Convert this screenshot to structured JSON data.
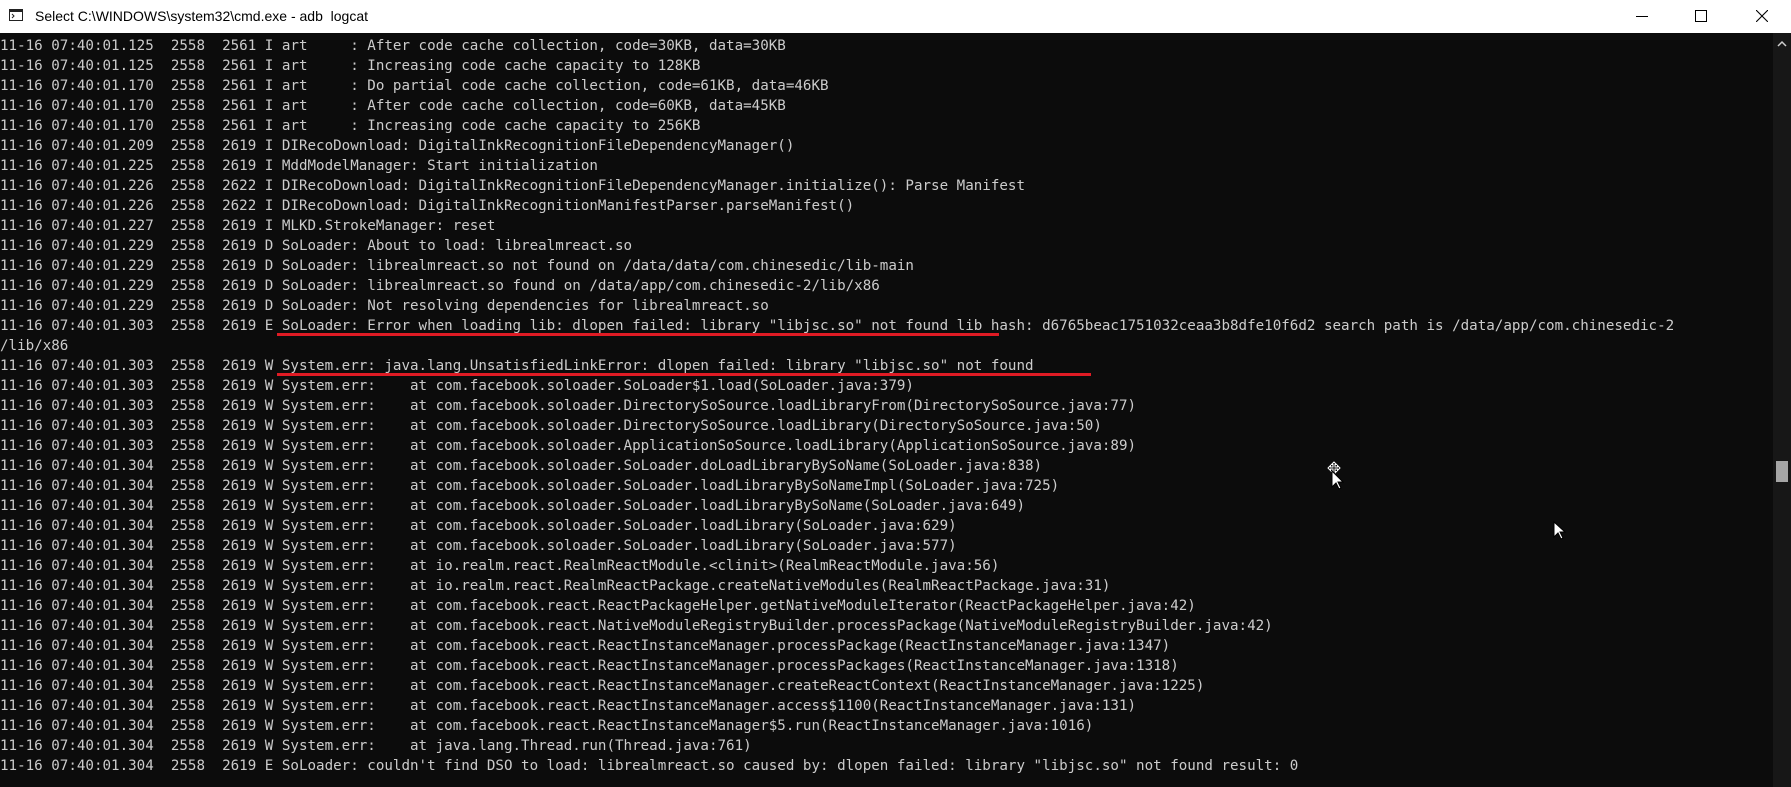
{
  "window": {
    "title": "Select C:\\WINDOWS\\system32\\cmd.exe - adb  logcat",
    "icons": [
      "cmd-icon",
      "minimize-icon",
      "maximize-icon",
      "close-icon"
    ]
  },
  "console": {
    "lines": [
      "11-16 07:40:01.125  2558  2561 I art     : After code cache collection, code=30KB, data=30KB",
      "11-16 07:40:01.125  2558  2561 I art     : Increasing code cache capacity to 128KB",
      "11-16 07:40:01.170  2558  2561 I art     : Do partial code cache collection, code=61KB, data=46KB",
      "11-16 07:40:01.170  2558  2561 I art     : After code cache collection, code=60KB, data=45KB",
      "11-16 07:40:01.170  2558  2561 I art     : Increasing code cache capacity to 256KB",
      "11-16 07:40:01.209  2558  2619 I DIRecoDownload: DigitalInkRecognitionFileDependencyManager()",
      "11-16 07:40:01.225  2558  2619 I MddModelManager: Start initialization",
      "11-16 07:40:01.226  2558  2622 I DIRecoDownload: DigitalInkRecognitionFileDependencyManager.initialize(): Parse Manifest",
      "11-16 07:40:01.226  2558  2622 I DIRecoDownload: DigitalInkRecognitionManifestParser.parseManifest()",
      "11-16 07:40:01.227  2558  2619 I MLKD.StrokeManager: reset",
      "11-16 07:40:01.229  2558  2619 D SoLoader: About to load: librealmreact.so",
      "11-16 07:40:01.229  2558  2619 D SoLoader: librealmreact.so not found on /data/data/com.chinesedic/lib-main",
      "11-16 07:40:01.229  2558  2619 D SoLoader: librealmreact.so found on /data/app/com.chinesedic-2/lib/x86",
      "11-16 07:40:01.229  2558  2619 D SoLoader: Not resolving dependencies for librealmreact.so",
      "11-16 07:40:01.303  2558  2619 E SoLoader: Error when loading lib: dlopen failed: library \"libjsc.so\" not found lib hash: d6765beac1751032ceaa3b8dfe10f6d2 search path is /data/app/com.chinesedic-2",
      "/lib/x86",
      "11-16 07:40:01.303  2558  2619 W System.err: java.lang.UnsatisfiedLinkError: dlopen failed: library \"libjsc.so\" not found",
      "11-16 07:40:01.303  2558  2619 W System.err:    at com.facebook.soloader.SoLoader$1.load(SoLoader.java:379)",
      "11-16 07:40:01.303  2558  2619 W System.err:    at com.facebook.soloader.DirectorySoSource.loadLibraryFrom(DirectorySoSource.java:77)",
      "11-16 07:40:01.303  2558  2619 W System.err:    at com.facebook.soloader.DirectorySoSource.loadLibrary(DirectorySoSource.java:50)",
      "11-16 07:40:01.303  2558  2619 W System.err:    at com.facebook.soloader.ApplicationSoSource.loadLibrary(ApplicationSoSource.java:89)",
      "11-16 07:40:01.304  2558  2619 W System.err:    at com.facebook.soloader.SoLoader.doLoadLibraryBySoName(SoLoader.java:838)",
      "11-16 07:40:01.304  2558  2619 W System.err:    at com.facebook.soloader.SoLoader.loadLibraryBySoNameImpl(SoLoader.java:725)",
      "11-16 07:40:01.304  2558  2619 W System.err:    at com.facebook.soloader.SoLoader.loadLibraryBySoName(SoLoader.java:649)",
      "11-16 07:40:01.304  2558  2619 W System.err:    at com.facebook.soloader.SoLoader.loadLibrary(SoLoader.java:629)",
      "11-16 07:40:01.304  2558  2619 W System.err:    at com.facebook.soloader.SoLoader.loadLibrary(SoLoader.java:577)",
      "11-16 07:40:01.304  2558  2619 W System.err:    at io.realm.react.RealmReactModule.<clinit>(RealmReactModule.java:56)",
      "11-16 07:40:01.304  2558  2619 W System.err:    at io.realm.react.RealmReactPackage.createNativeModules(RealmReactPackage.java:31)",
      "11-16 07:40:01.304  2558  2619 W System.err:    at com.facebook.react.ReactPackageHelper.getNativeModuleIterator(ReactPackageHelper.java:42)",
      "11-16 07:40:01.304  2558  2619 W System.err:    at com.facebook.react.NativeModuleRegistryBuilder.processPackage(NativeModuleRegistryBuilder.java:42)",
      "11-16 07:40:01.304  2558  2619 W System.err:    at com.facebook.react.ReactInstanceManager.processPackage(ReactInstanceManager.java:1347)",
      "11-16 07:40:01.304  2558  2619 W System.err:    at com.facebook.react.ReactInstanceManager.processPackages(ReactInstanceManager.java:1318)",
      "11-16 07:40:01.304  2558  2619 W System.err:    at com.facebook.react.ReactInstanceManager.createReactContext(ReactInstanceManager.java:1225)",
      "11-16 07:40:01.304  2558  2619 W System.err:    at com.facebook.react.ReactInstanceManager.access$1100(ReactInstanceManager.java:131)",
      "11-16 07:40:01.304  2558  2619 W System.err:    at com.facebook.react.ReactInstanceManager$5.run(ReactInstanceManager.java:1016)",
      "11-16 07:40:01.304  2558  2619 W System.err:    at java.lang.Thread.run(Thread.java:761)",
      "11-16 07:40:01.304  2558  2619 E SoLoader: couldn't find DSO to load: librealmreact.so caused by: dlopen failed: library \"libjsc.so\" not found result: 0"
    ]
  },
  "colors": {
    "background": "#0c0c0c",
    "text": "#cccccc",
    "underline": "#e01b24"
  }
}
